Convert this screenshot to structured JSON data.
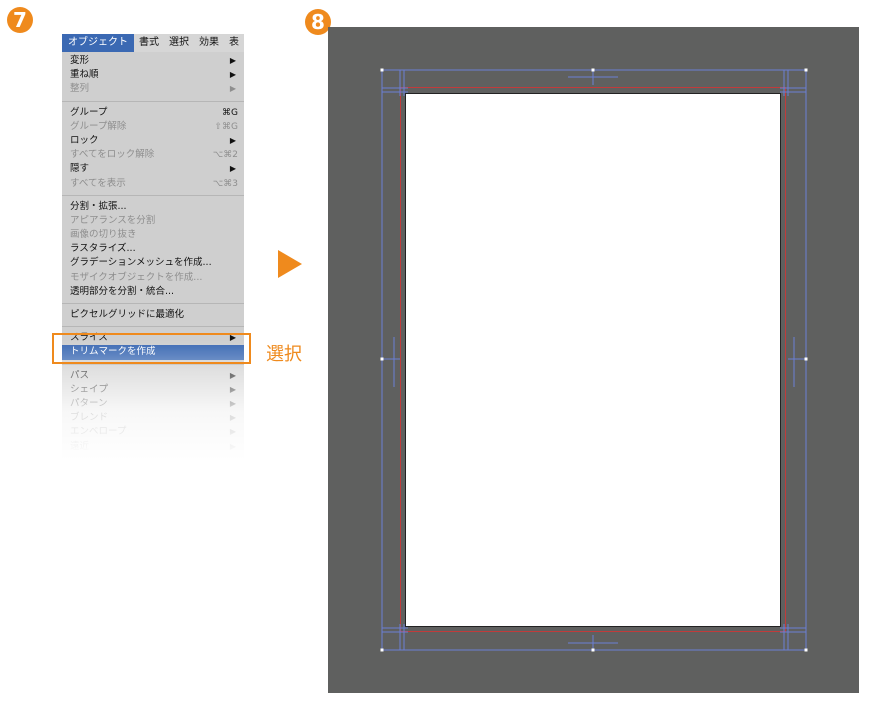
{
  "steps": {
    "step7": "7",
    "step8": "8"
  },
  "menubar": {
    "items": [
      "オブジェクト",
      "書式",
      "選択",
      "効果",
      "表"
    ]
  },
  "menu": {
    "items": [
      {
        "label": "変形",
        "shortcut": "",
        "arrow": true,
        "disabled": false
      },
      {
        "label": "重ね順",
        "shortcut": "",
        "arrow": true,
        "disabled": false
      },
      {
        "label": "整列",
        "shortcut": "",
        "arrow": true,
        "disabled": true
      },
      {
        "sep": true
      },
      {
        "label": "グループ",
        "shortcut": "⌘G",
        "arrow": false,
        "disabled": false
      },
      {
        "label": "グループ解除",
        "shortcut": "⇧⌘G",
        "arrow": false,
        "disabled": true
      },
      {
        "label": "ロック",
        "shortcut": "",
        "arrow": true,
        "disabled": false
      },
      {
        "label": "すべてをロック解除",
        "shortcut": "⌥⌘2",
        "arrow": false,
        "disabled": true
      },
      {
        "label": "隠す",
        "shortcut": "",
        "arrow": true,
        "disabled": false
      },
      {
        "label": "すべてを表示",
        "shortcut": "⌥⌘3",
        "arrow": false,
        "disabled": true
      },
      {
        "sep": true
      },
      {
        "label": "分割・拡張...",
        "shortcut": "",
        "arrow": false,
        "disabled": false
      },
      {
        "label": "アピアランスを分割",
        "shortcut": "",
        "arrow": false,
        "disabled": true
      },
      {
        "label": "画像の切り抜き",
        "shortcut": "",
        "arrow": false,
        "disabled": true
      },
      {
        "label": "ラスタライズ...",
        "shortcut": "",
        "arrow": false,
        "disabled": false
      },
      {
        "label": "グラデーションメッシュを作成...",
        "shortcut": "",
        "arrow": false,
        "disabled": false
      },
      {
        "label": "モザイクオブジェクトを作成...",
        "shortcut": "",
        "arrow": false,
        "disabled": true
      },
      {
        "label": "透明部分を分割・統合...",
        "shortcut": "",
        "arrow": false,
        "disabled": false
      },
      {
        "sep": true
      },
      {
        "label": "ピクセルグリッドに最適化",
        "shortcut": "",
        "arrow": false,
        "disabled": false
      },
      {
        "sep": true
      },
      {
        "label": "スライス",
        "shortcut": "",
        "arrow": true,
        "disabled": false
      },
      {
        "label": "トリムマークを作成",
        "shortcut": "",
        "arrow": false,
        "disabled": false,
        "highlighted": true
      },
      {
        "sep": true
      },
      {
        "label": "パス",
        "shortcut": "",
        "arrow": true,
        "disabled": false
      },
      {
        "label": "シェイプ",
        "shortcut": "",
        "arrow": true,
        "disabled": false
      },
      {
        "label": "パターン",
        "shortcut": "",
        "arrow": true,
        "disabled": false
      },
      {
        "label": "ブレンド",
        "shortcut": "",
        "arrow": true,
        "disabled": false
      },
      {
        "label": "エンベロープ",
        "shortcut": "",
        "arrow": true,
        "disabled": false
      },
      {
        "label": "遠近",
        "shortcut": "",
        "arrow": true,
        "disabled": false
      }
    ]
  },
  "callout": {
    "label": "選択"
  },
  "colors": {
    "accent": "#ef8a1d",
    "menu_bg": "#cfcfcf",
    "highlight": "#3b69b3",
    "canvas_bg": "#5f605f",
    "guide": "#6b7fd6",
    "bleed": "#c13b3b"
  }
}
